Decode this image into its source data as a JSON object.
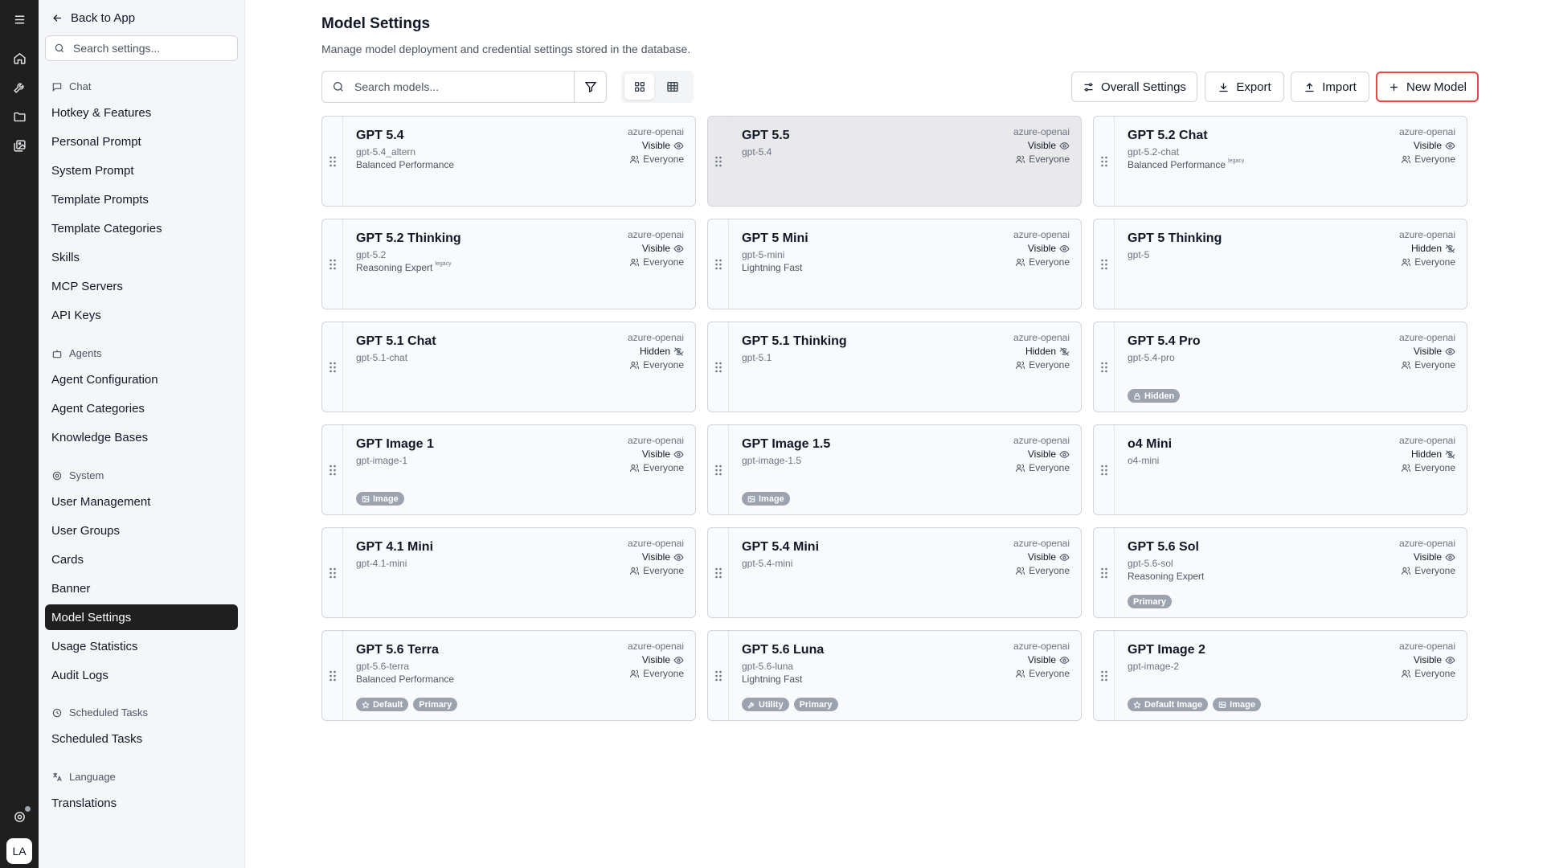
{
  "sidebar": {
    "back_label": "Back to App",
    "search_placeholder": "Search settings...",
    "sections": {
      "chat": "Chat",
      "agents": "Agents",
      "system": "System",
      "scheduled": "Scheduled Tasks",
      "language": "Language"
    },
    "items": {
      "hotkey": "Hotkey & Features",
      "personal_prompt": "Personal Prompt",
      "system_prompt": "System Prompt",
      "template_prompts": "Template Prompts",
      "template_categories": "Template Categories",
      "skills": "Skills",
      "mcp_servers": "MCP Servers",
      "api_keys": "API Keys",
      "agent_configuration": "Agent Configuration",
      "agent_categories": "Agent Categories",
      "knowledge_bases": "Knowledge Bases",
      "user_management": "User Management",
      "user_groups": "User Groups",
      "cards": "Cards",
      "banner": "Banner",
      "model_settings": "Model Settings",
      "usage_statistics": "Usage Statistics",
      "audit_logs": "Audit Logs",
      "scheduled_tasks": "Scheduled Tasks",
      "translations": "Translations"
    },
    "active": "Model Settings"
  },
  "rail": {
    "avatar_initials": "LA"
  },
  "main": {
    "title": "Model Settings",
    "subtitle": "Manage model deployment and credential settings stored in the database.",
    "search_placeholder": "Search models...",
    "buttons": {
      "overall_settings": "Overall Settings",
      "export": "Export",
      "import": "Import",
      "new_model": "New Model"
    }
  },
  "models": [
    {
      "name": "GPT 5.4",
      "id": "gpt-5.4_altern",
      "desc": "Balanced Performance",
      "legacy": "",
      "provider": "azure-openai",
      "visibility": "Visible",
      "audience": "Everyone",
      "badges": []
    },
    {
      "name": "GPT 5.5",
      "id": "gpt-5.4",
      "desc": "",
      "legacy": "",
      "provider": "azure-openai",
      "visibility": "Visible",
      "audience": "Everyone",
      "badges": []
    },
    {
      "name": "GPT 5.2 Chat",
      "id": "gpt-5.2-chat",
      "desc": "Balanced Performance",
      "legacy": "legacy",
      "provider": "azure-openai",
      "visibility": "Visible",
      "audience": "Everyone",
      "badges": []
    },
    {
      "name": "GPT 5.2 Thinking",
      "id": "gpt-5.2",
      "desc": "Reasoning Expert",
      "legacy": "legacy",
      "provider": "azure-openai",
      "visibility": "Visible",
      "audience": "Everyone",
      "badges": []
    },
    {
      "name": "GPT 5 Mini",
      "id": "gpt-5-mini",
      "desc": "Lightning Fast",
      "legacy": "",
      "provider": "azure-openai",
      "visibility": "Visible",
      "audience": "Everyone",
      "badges": []
    },
    {
      "name": "GPT 5 Thinking",
      "id": "gpt-5",
      "desc": "",
      "legacy": "",
      "provider": "azure-openai",
      "visibility": "Hidden",
      "audience": "Everyone",
      "badges": []
    },
    {
      "name": "GPT 5.1 Chat",
      "id": "gpt-5.1-chat",
      "desc": "",
      "legacy": "",
      "provider": "azure-openai",
      "visibility": "Hidden",
      "audience": "Everyone",
      "badges": []
    },
    {
      "name": "GPT 5.1 Thinking",
      "id": "gpt-5.1",
      "desc": "",
      "legacy": "",
      "provider": "azure-openai",
      "visibility": "Hidden",
      "audience": "Everyone",
      "badges": []
    },
    {
      "name": "GPT 5.4 Pro",
      "id": "gpt-5.4-pro",
      "desc": "",
      "legacy": "",
      "provider": "azure-openai",
      "visibility": "Visible",
      "audience": "Everyone",
      "badges": [
        {
          "label": "Hidden",
          "icon": "lock-icon"
        }
      ]
    },
    {
      "name": "GPT Image 1",
      "id": "gpt-image-1",
      "desc": "",
      "legacy": "",
      "provider": "azure-openai",
      "visibility": "Visible",
      "audience": "Everyone",
      "badges": [
        {
          "label": "Image",
          "icon": "image-icon"
        }
      ]
    },
    {
      "name": "GPT Image 1.5",
      "id": "gpt-image-1.5",
      "desc": "",
      "legacy": "",
      "provider": "azure-openai",
      "visibility": "Visible",
      "audience": "Everyone",
      "badges": [
        {
          "label": "Image",
          "icon": "image-icon"
        }
      ]
    },
    {
      "name": "o4 Mini",
      "id": "o4-mini",
      "desc": "",
      "legacy": "",
      "provider": "azure-openai",
      "visibility": "Hidden",
      "audience": "Everyone",
      "badges": []
    },
    {
      "name": "GPT 4.1 Mini",
      "id": "gpt-4.1-mini",
      "desc": "",
      "legacy": "",
      "provider": "azure-openai",
      "visibility": "Visible",
      "audience": "Everyone",
      "badges": []
    },
    {
      "name": "GPT 5.4 Mini",
      "id": "gpt-5.4-mini",
      "desc": "",
      "legacy": "",
      "provider": "azure-openai",
      "visibility": "Visible",
      "audience": "Everyone",
      "badges": []
    },
    {
      "name": "GPT 5.6 Sol",
      "id": "gpt-5.6-sol",
      "desc": "Reasoning Expert",
      "legacy": "",
      "provider": "azure-openai",
      "visibility": "Visible",
      "audience": "Everyone",
      "badges": [
        {
          "label": "Primary",
          "icon": ""
        }
      ]
    },
    {
      "name": "GPT 5.6 Terra",
      "id": "gpt-5.6-terra",
      "desc": "Balanced Performance",
      "legacy": "",
      "provider": "azure-openai",
      "visibility": "Visible",
      "audience": "Everyone",
      "badges": [
        {
          "label": "Default",
          "icon": "star-icon"
        },
        {
          "label": "Primary",
          "icon": ""
        }
      ]
    },
    {
      "name": "GPT 5.6 Luna",
      "id": "gpt-5.6-luna",
      "desc": "Lightning Fast",
      "legacy": "",
      "provider": "azure-openai",
      "visibility": "Visible",
      "audience": "Everyone",
      "badges": [
        {
          "label": "Utility",
          "icon": "wrench-icon"
        },
        {
          "label": "Primary",
          "icon": ""
        }
      ]
    },
    {
      "name": "GPT Image 2",
      "id": "gpt-image-2",
      "desc": "",
      "legacy": "",
      "provider": "azure-openai",
      "visibility": "Visible",
      "audience": "Everyone",
      "badges": [
        {
          "label": "Default Image",
          "icon": "star-icon"
        },
        {
          "label": "Image",
          "icon": "image-icon"
        }
      ]
    }
  ]
}
